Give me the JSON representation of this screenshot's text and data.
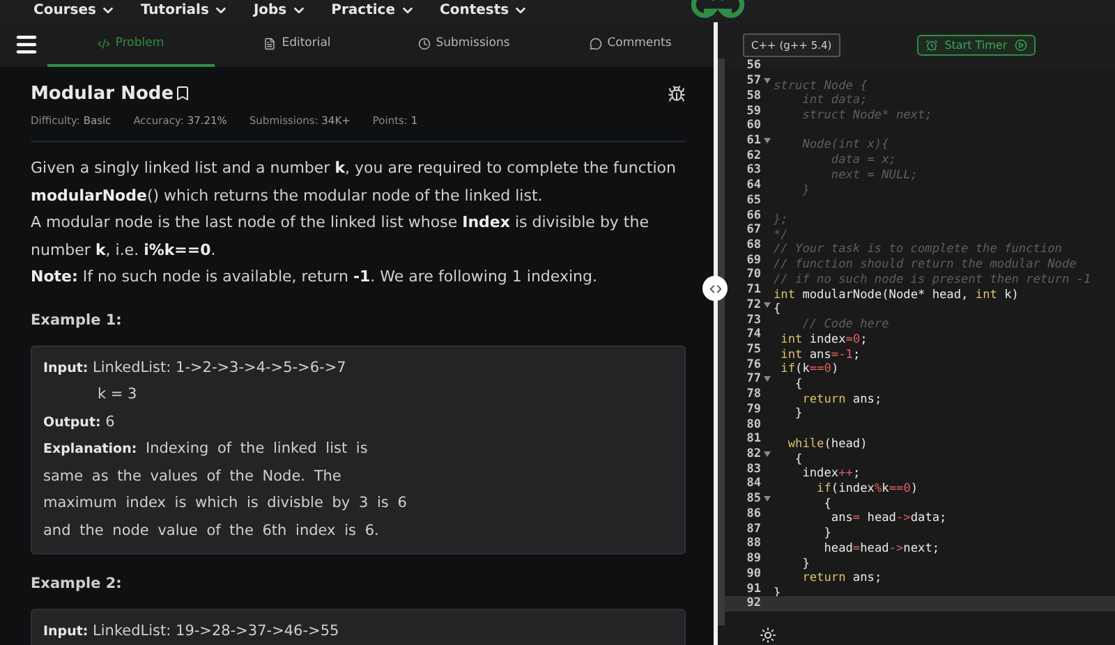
{
  "top_nav": {
    "items": [
      {
        "label": "Courses"
      },
      {
        "label": "Tutorials"
      },
      {
        "label": "Jobs"
      },
      {
        "label": "Practice"
      },
      {
        "label": "Contests"
      }
    ]
  },
  "tabs": [
    {
      "label": "Problem",
      "selected": true
    },
    {
      "label": "Editorial",
      "selected": false
    },
    {
      "label": "Submissions",
      "selected": false
    },
    {
      "label": "Comments",
      "selected": false
    }
  ],
  "problem": {
    "title": "Modular Node",
    "meta": [
      {
        "label": "Difficulty:",
        "value": "Basic"
      },
      {
        "label": "Accuracy:",
        "value": "37.21%"
      },
      {
        "label": "Submissions:",
        "value": "34K+"
      },
      {
        "label": "Points:",
        "value": "1"
      }
    ],
    "paragraphs": [
      "Given a singly linked list and a number **k**, you are required to complete the function **modularNode**() which returns the modular node of the linked list.",
      "A modular node is the last node of the linked list whose **Index** is divisible by the number **k**, i.e. **i%k==0**.",
      "**Note:** If no such node is available, return **-1**. We are following 1 indexing."
    ],
    "examples": [
      {
        "heading": "Example 1:",
        "lines": [
          {
            "kind": "line",
            "text": "**Input:** LinkedList: 1->2->3->4->5->6->7"
          },
          {
            "kind": "indent",
            "text": "k = 3"
          },
          {
            "kind": "line",
            "text": "**Output:** 6"
          },
          {
            "kind": "wrap",
            "text": "**Explanation:** Indexing of the linked list is same as the values of the Node. The maximum index is which is divisble by 3 is 6 and the node value of the 6th index is 6."
          }
        ]
      },
      {
        "heading": "Example 2:",
        "lines": [
          {
            "kind": "line",
            "text": "**Input:** LinkedList: 19->28->37->46->55"
          }
        ]
      }
    ]
  },
  "editor": {
    "language": "C++ (g++ 5.4)",
    "timer_button": "Start Timer",
    "lines": [
      {
        "number": "56",
        "fold": false,
        "active": false
      },
      {
        "number": "57",
        "fold": true,
        "active": false,
        "tokens": [
          {
            "kind": "comment",
            "text": "struct Node {"
          }
        ]
      },
      {
        "number": "58",
        "fold": false,
        "active": false,
        "tokens": [
          {
            "kind": "comment",
            "text": "    int data;"
          }
        ]
      },
      {
        "number": "59",
        "fold": false,
        "active": false,
        "tokens": [
          {
            "kind": "comment",
            "text": "    struct Node* next;"
          }
        ]
      },
      {
        "number": "60",
        "fold": false,
        "active": false
      },
      {
        "number": "61",
        "fold": true,
        "active": false,
        "tokens": [
          {
            "kind": "comment",
            "text": "    Node(int x){"
          }
        ]
      },
      {
        "number": "62",
        "fold": false,
        "active": false,
        "tokens": [
          {
            "kind": "comment",
            "text": "        data = x;"
          }
        ]
      },
      {
        "number": "63",
        "fold": false,
        "active": false,
        "tokens": [
          {
            "kind": "comment",
            "text": "        next = NULL;"
          }
        ]
      },
      {
        "number": "64",
        "fold": false,
        "active": false,
        "tokens": [
          {
            "kind": "comment",
            "text": "    }"
          }
        ]
      },
      {
        "number": "65",
        "fold": false,
        "active": false
      },
      {
        "number": "66",
        "fold": false,
        "active": false,
        "tokens": [
          {
            "kind": "comment",
            "text": "};"
          }
        ]
      },
      {
        "number": "67",
        "fold": false,
        "active": false,
        "tokens": [
          {
            "kind": "comment",
            "text": "*/"
          }
        ]
      },
      {
        "number": "68",
        "fold": false,
        "active": false,
        "tokens": [
          {
            "kind": "comment",
            "text": "// Your task is to complete the function"
          }
        ]
      },
      {
        "number": "69",
        "fold": false,
        "active": false,
        "tokens": [
          {
            "kind": "comment",
            "text": "// function should return the modular Node"
          }
        ]
      },
      {
        "number": "70",
        "fold": false,
        "active": false,
        "tokens": [
          {
            "kind": "comment",
            "text": "// if no such node is present then return -1"
          }
        ]
      },
      {
        "number": "71",
        "fold": false,
        "active": false,
        "tokens": [
          {
            "kind": "keyword",
            "text": "int"
          },
          {
            "kind": "plain",
            "text": " modularNode(Node* head, "
          },
          {
            "kind": "keyword",
            "text": "int"
          },
          {
            "kind": "plain",
            "text": " k)"
          }
        ]
      },
      {
        "number": "72",
        "fold": true,
        "active": false,
        "tokens": [
          {
            "kind": "plain",
            "text": "{"
          }
        ]
      },
      {
        "number": "73",
        "fold": false,
        "active": false,
        "tokens": [
          {
            "kind": "comment",
            "text": "    // Code here"
          }
        ]
      },
      {
        "number": "74",
        "fold": false,
        "active": false,
        "tokens": [
          {
            "kind": "keyword",
            "text": " int"
          },
          {
            "kind": "plain",
            "text": " index"
          },
          {
            "kind": "operator",
            "text": "="
          },
          {
            "kind": "number",
            "text": "0"
          },
          {
            "kind": "plain",
            "text": ";"
          }
        ]
      },
      {
        "number": "75",
        "fold": false,
        "active": false,
        "tokens": [
          {
            "kind": "keyword",
            "text": " int"
          },
          {
            "kind": "plain",
            "text": " ans"
          },
          {
            "kind": "operator",
            "text": "=-"
          },
          {
            "kind": "number",
            "text": "1"
          },
          {
            "kind": "plain",
            "text": ";"
          }
        ]
      },
      {
        "number": "76",
        "fold": false,
        "active": false,
        "tokens": [
          {
            "kind": "keyword",
            "text": " if"
          },
          {
            "kind": "plain",
            "text": "(k"
          },
          {
            "kind": "operator",
            "text": "=="
          },
          {
            "kind": "number",
            "text": "0"
          },
          {
            "kind": "plain",
            "text": ")"
          }
        ]
      },
      {
        "number": "77",
        "fold": true,
        "active": false,
        "tokens": [
          {
            "kind": "plain",
            "text": "   {"
          }
        ]
      },
      {
        "number": "78",
        "fold": false,
        "active": false,
        "tokens": [
          {
            "kind": "keyword",
            "text": "    return"
          },
          {
            "kind": "plain",
            "text": " ans;"
          }
        ]
      },
      {
        "number": "79",
        "fold": false,
        "active": false,
        "tokens": [
          {
            "kind": "plain",
            "text": "   }"
          }
        ]
      },
      {
        "number": "80",
        "fold": false,
        "active": false
      },
      {
        "number": "81",
        "fold": false,
        "active": false,
        "tokens": [
          {
            "kind": "keyword",
            "text": "  while"
          },
          {
            "kind": "plain",
            "text": "(head)"
          }
        ]
      },
      {
        "number": "82",
        "fold": true,
        "active": false,
        "tokens": [
          {
            "kind": "plain",
            "text": "   {"
          }
        ]
      },
      {
        "number": "83",
        "fold": false,
        "active": false,
        "tokens": [
          {
            "kind": "plain",
            "text": "    index"
          },
          {
            "kind": "operator",
            "text": "++"
          },
          {
            "kind": "plain",
            "text": ";"
          }
        ]
      },
      {
        "number": "84",
        "fold": false,
        "active": false,
        "tokens": [
          {
            "kind": "keyword",
            "text": "      if"
          },
          {
            "kind": "plain",
            "text": "(index"
          },
          {
            "kind": "operator",
            "text": "%"
          },
          {
            "kind": "plain",
            "text": "k"
          },
          {
            "kind": "operator",
            "text": "=="
          },
          {
            "kind": "number",
            "text": "0"
          },
          {
            "kind": "plain",
            "text": ")"
          }
        ]
      },
      {
        "number": "85",
        "fold": true,
        "active": false,
        "tokens": [
          {
            "kind": "plain",
            "text": "       {"
          }
        ]
      },
      {
        "number": "86",
        "fold": false,
        "active": false,
        "tokens": [
          {
            "kind": "plain",
            "text": "        ans"
          },
          {
            "kind": "operator",
            "text": "="
          },
          {
            "kind": "plain",
            "text": " head"
          },
          {
            "kind": "operator",
            "text": "->"
          },
          {
            "kind": "plain",
            "text": "data;"
          }
        ]
      },
      {
        "number": "87",
        "fold": false,
        "active": false,
        "tokens": [
          {
            "kind": "plain",
            "text": "       }"
          }
        ]
      },
      {
        "number": "88",
        "fold": false,
        "active": false,
        "tokens": [
          {
            "kind": "plain",
            "text": "       head"
          },
          {
            "kind": "operator",
            "text": "="
          },
          {
            "kind": "plain",
            "text": "head"
          },
          {
            "kind": "operator",
            "text": "->"
          },
          {
            "kind": "plain",
            "text": "next;"
          }
        ]
      },
      {
        "number": "89",
        "fold": false,
        "active": false,
        "tokens": [
          {
            "kind": "plain",
            "text": "    }"
          }
        ]
      },
      {
        "number": "90",
        "fold": false,
        "active": false,
        "tokens": [
          {
            "kind": "keyword",
            "text": "    return"
          },
          {
            "kind": "plain",
            "text": " ans;"
          }
        ]
      },
      {
        "number": "91",
        "fold": false,
        "active": false,
        "tokens": [
          {
            "kind": "plain",
            "text": "}"
          }
        ]
      },
      {
        "number": "92",
        "fold": false,
        "active": true
      }
    ]
  }
}
